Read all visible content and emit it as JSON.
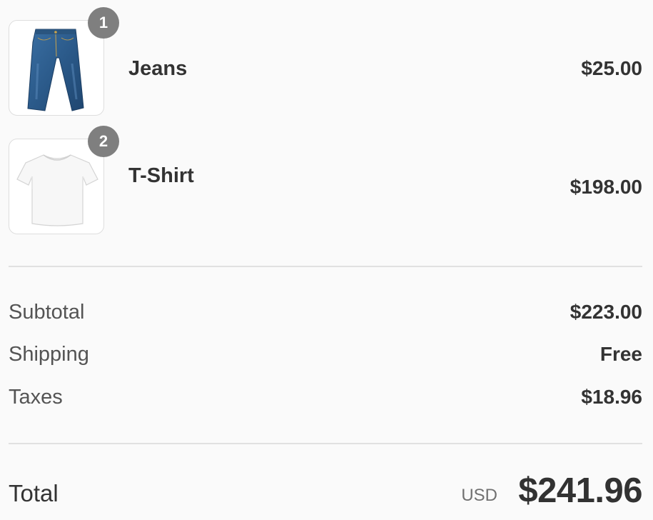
{
  "order": {
    "items": [
      {
        "name": "Jeans",
        "quantity": "1",
        "price": "$25.00",
        "image_icon": "jeans-image"
      },
      {
        "name": "T-Shirt",
        "quantity": "2",
        "price": "$198.00",
        "image_icon": "tshirt-image"
      }
    ],
    "summary": {
      "subtotal_label": "Subtotal",
      "subtotal_value": "$223.00",
      "shipping_label": "Shipping",
      "shipping_value": "Free",
      "taxes_label": "Taxes",
      "taxes_value": "$18.96"
    },
    "total": {
      "label": "Total",
      "currency": "USD",
      "amount": "$241.96"
    }
  },
  "colors": {
    "background": "#fafafa",
    "badge": "#7f7f7f",
    "divider": "#e1e1e1",
    "text": "#323232"
  }
}
